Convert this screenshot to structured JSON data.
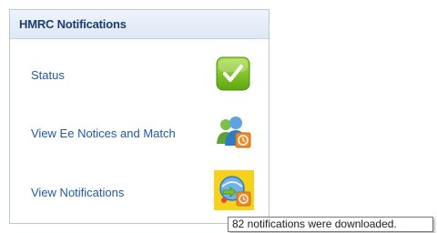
{
  "panel": {
    "title": "HMRC Notifications",
    "items": [
      {
        "label": "Status",
        "icon": "check-status-icon"
      },
      {
        "label": "View Ee Notices and Match",
        "icon": "employee-notices-icon"
      },
      {
        "label": "View Notifications",
        "icon": "notifications-icon"
      }
    ]
  },
  "tooltip": {
    "text": "82 notifications were downloaded."
  },
  "colors": {
    "header_text": "#1e3c6e",
    "link_text": "#1f5aa6",
    "status_green": "#79c21f",
    "highlight_yellow": "#f6d21a",
    "badge_orange": "#f08a24"
  }
}
